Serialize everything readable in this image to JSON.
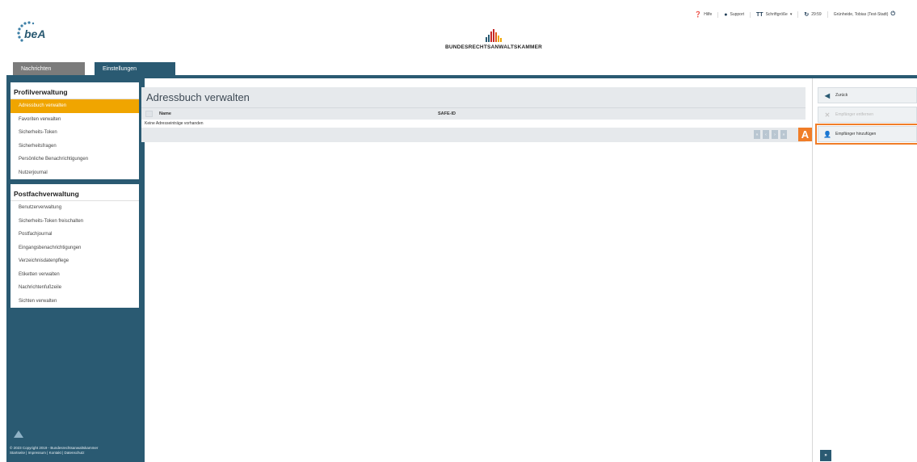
{
  "topbar": {
    "help_label": "Hilfe",
    "support_label": "Support",
    "fontsize_label": "Schriftgröße",
    "timer_label": "29:59",
    "user_label": "Grünheide, Tobias (Test-Stadt)"
  },
  "header": {
    "brand_name": "BUNDESRECHTSANWALTSKAMMER",
    "brand_colors": [
      "#2a5a72",
      "#2a5a72",
      "#c62828",
      "#c62828",
      "#e05a1b",
      "#f0a500",
      "#f0a500"
    ]
  },
  "tabs": [
    {
      "label": "Nachrichten"
    },
    {
      "label": "Einstellungen"
    }
  ],
  "sidebar": {
    "profile": {
      "title": "Profilverwaltung",
      "items": [
        {
          "label": "Adressbuch verwalten"
        },
        {
          "label": "Favoriten verwalten"
        },
        {
          "label": "Sicherheits-Token"
        },
        {
          "label": "Sicherheitsfragen"
        },
        {
          "label": "Persönliche Benachrichtigungen"
        },
        {
          "label": "Nutzerjournal"
        }
      ]
    },
    "mailbox": {
      "title": "Postfachverwaltung",
      "items": [
        {
          "label": "Benutzerverwaltung"
        },
        {
          "label": "Sicherheits-Token freischalten"
        },
        {
          "label": "Postfachjournal"
        },
        {
          "label": "Eingangsbenachrichtigungen"
        },
        {
          "label": "Verzeichnisdatenpflege"
        },
        {
          "label": "Etiketten verwalten"
        },
        {
          "label": "Nachrichtenfußzeile"
        },
        {
          "label": "Sichten verwalten"
        }
      ]
    },
    "footer": {
      "copyright": "© 2023 Copyright 2019 - Bundesrechtsanwaltskammer",
      "links": "Startseite | Impressum | Kontakt | Datenschutz"
    }
  },
  "main": {
    "title": "Adressbuch verwalten",
    "columns": [
      "Name",
      "SAFE-ID"
    ],
    "empty_text": "Keine Adresseinträge vorhanden",
    "pager": [
      "«",
      "‹",
      "›",
      "»"
    ]
  },
  "actions": {
    "back_label": "Zurück",
    "remove_label": "Empfänger entfernen",
    "add_label": "Empfänger hinzufügen",
    "marker": "A",
    "bottom_button": "»"
  },
  "colors": {
    "primary": "#2a5a72",
    "active_item": "#f0a500",
    "highlight": "#f07d28"
  }
}
